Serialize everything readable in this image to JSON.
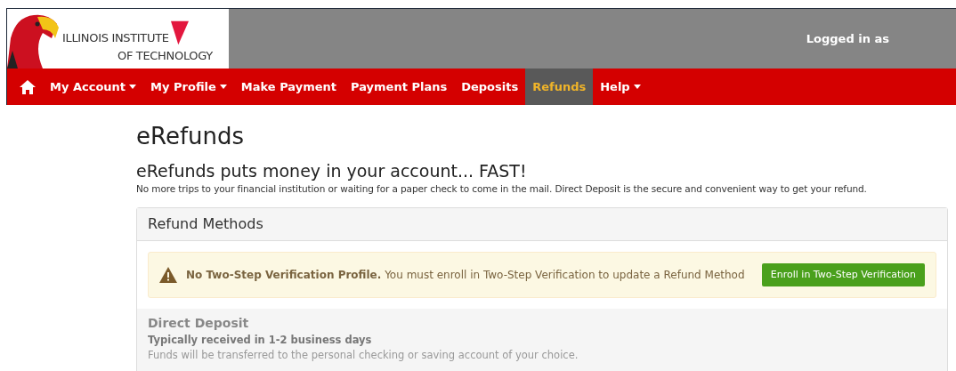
{
  "header": {
    "logo": {
      "line_1": "ILLINOIS INSTITUTE",
      "line_2": "OF TECHNOLOGY"
    },
    "login_text": "Logged in as"
  },
  "nav": [
    {
      "label": "My Account",
      "dropdown": true,
      "selected": false
    },
    {
      "label": "My Profile",
      "dropdown": true,
      "selected": false
    },
    {
      "label": "Make Payment",
      "dropdown": false,
      "selected": false
    },
    {
      "label": "Payment Plans",
      "dropdown": false,
      "selected": false
    },
    {
      "label": "Deposits",
      "dropdown": false,
      "selected": false
    },
    {
      "label": "Refunds",
      "dropdown": false,
      "selected": true
    },
    {
      "label": "Help",
      "dropdown": true,
      "selected": false
    }
  ],
  "page": {
    "title": "eRefunds",
    "subtitle": "eRefunds puts money in your account... FAST!",
    "intro": "No more trips to your financial institution or waiting for a paper check to come in the mail. Direct Deposit is the secure and convenient way to get your refund."
  },
  "panel": {
    "title": "Refund Methods",
    "alert": {
      "text": "**No Two-Step Verification Profile.** You must enroll in Two-Step Verification to update a Refund Method",
      "button": "Enroll in Two-Step Verification"
    },
    "method": {
      "title": "Direct Deposit",
      "timing": "Typically received in 1-2 business days",
      "description": "Funds will be transferred to the personal checking or saving account of your choice."
    }
  }
}
